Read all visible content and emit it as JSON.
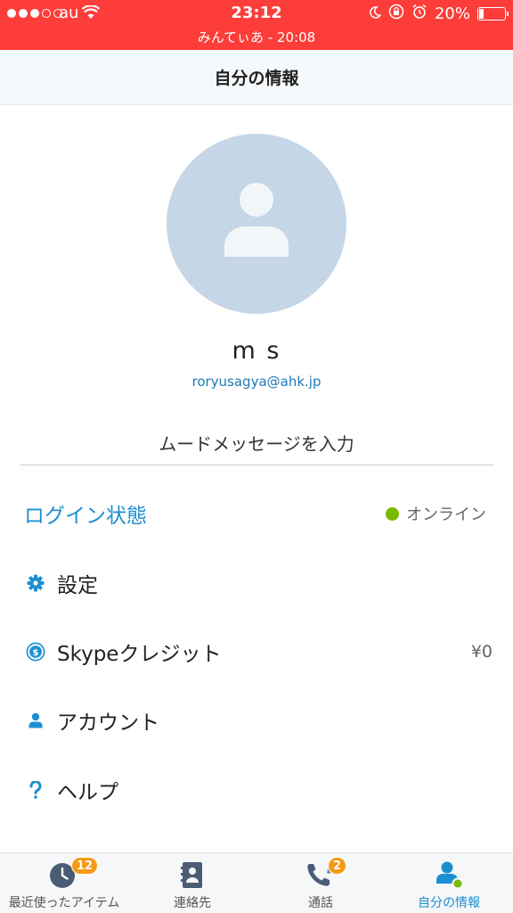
{
  "status_bar": {
    "carrier": "au",
    "time": "23:12",
    "battery": "20%",
    "call_banner": "みんてぃあ - 20:08"
  },
  "header": {
    "title": "自分の情報"
  },
  "profile": {
    "name": "m s",
    "email": "roryusagya@ahk.jp",
    "mood_placeholder": "ムードメッセージを入力"
  },
  "login": {
    "label": "ログイン状態",
    "status": "オンライン",
    "status_color": "#7ab800"
  },
  "menu": {
    "settings": {
      "label": "設定",
      "icon": "gear-icon"
    },
    "skype_credit": {
      "label": "Skypeクレジット",
      "value": "¥0",
      "icon": "dollar-circle-icon"
    },
    "account": {
      "label": "アカウント",
      "icon": "person-icon"
    },
    "help": {
      "label": "ヘルプ",
      "icon": "question-icon"
    }
  },
  "tabs": [
    {
      "label": "最近使ったアイテム",
      "badge": "12",
      "icon": "clock-icon"
    },
    {
      "label": "連絡先",
      "icon": "contacts-book-icon"
    },
    {
      "label": "通話",
      "badge": "2",
      "icon": "phone-icon"
    },
    {
      "label": "自分の情報",
      "icon": "profile-icon",
      "active": true
    }
  ],
  "colors": {
    "status_bar": "#fc3d39",
    "accent": "#1d8fd1",
    "badge": "#f59a15",
    "avatar_bg": "#c5d6e6"
  }
}
